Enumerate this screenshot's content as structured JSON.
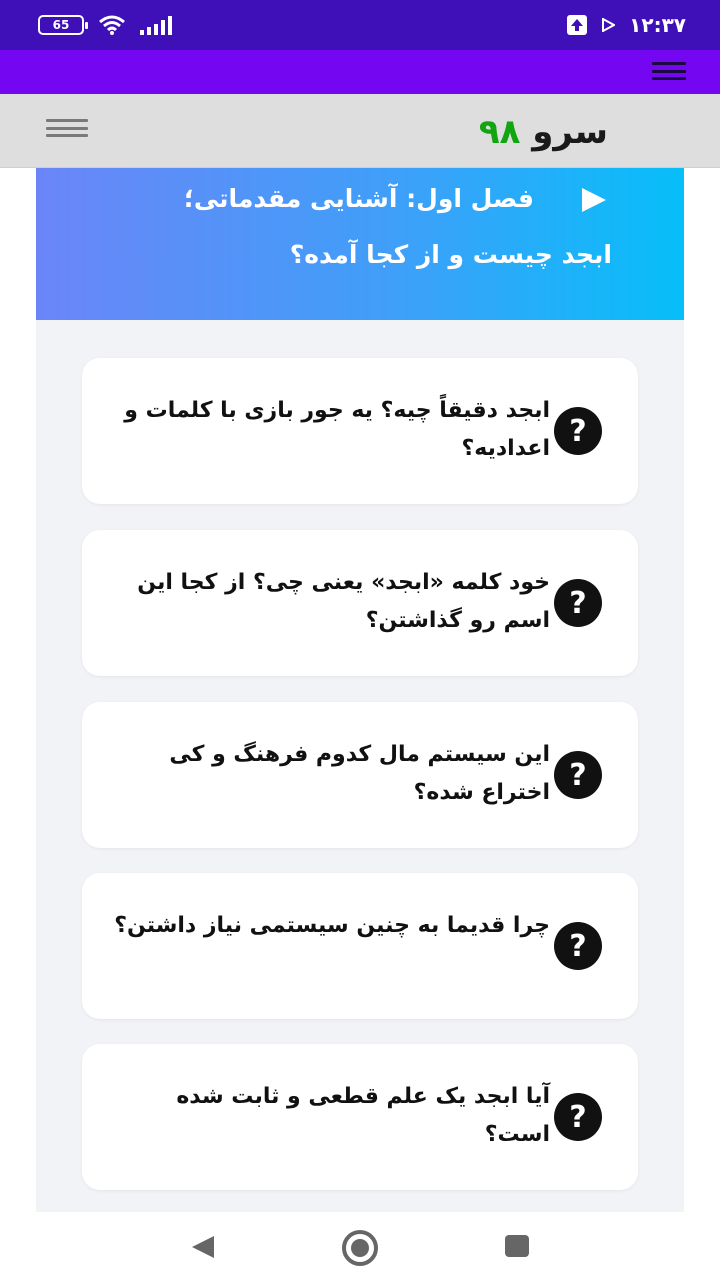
{
  "status_bar": {
    "battery": "65",
    "time": "۱۲:۳۷"
  },
  "header": {
    "logo_part1": "سرو",
    "logo_part2": "۹۸"
  },
  "hero": {
    "line1": "فصل اول: آشنایی مقدماتی؛",
    "line2": "ابجد چیست و از کجا آمده؟"
  },
  "questions": [
    "ابجد دقیقاً چیه؟ یه جور بازی با کلمات و اعدادیه؟",
    "خود کلمه «ابجد» یعنی چی؟ از کجا این اسم رو گذاشتن؟",
    "این سیستم مال کدوم فرهنگ و کی اختراع شده؟",
    "چرا قدیما به چنین سیستمی نیاز داشتن؟",
    "آیا ابجد یک علم قطعی و ثابت شده است؟"
  ],
  "icons": {
    "question": "question-circle-icon",
    "play": "play-triangle-icon",
    "menu": "hamburger-menu-icon"
  },
  "colors": {
    "status_bar": "#3f0fb8",
    "purple_bar": "#7406f2",
    "hero_start": "#6b85f8",
    "hero_end": "#07bef9",
    "logo_green": "#12a512"
  }
}
